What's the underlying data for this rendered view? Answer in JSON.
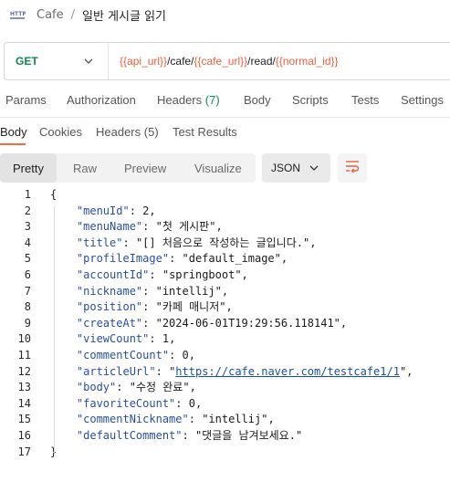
{
  "breadcrumb": {
    "parent": "Cafe",
    "separator": "/",
    "current": "일반 게시글 읽기"
  },
  "request": {
    "method": "GET",
    "url_parts": [
      {
        "text": "{{api_url}}",
        "var": true
      },
      {
        "text": "/cafe/",
        "var": false
      },
      {
        "text": "{{cafe_url}}",
        "var": true
      },
      {
        "text": "/read/",
        "var": false
      },
      {
        "text": "{{normal_id}}",
        "var": true
      }
    ]
  },
  "request_tabs": {
    "params": "Params",
    "authorization": "Authorization",
    "headers": "Headers",
    "headers_count": "(7)",
    "body": "Body",
    "scripts": "Scripts",
    "tests": "Tests",
    "settings": "Settings"
  },
  "response_tabs": {
    "body": "Body",
    "cookies": "Cookies",
    "headers": "Headers",
    "headers_count": "(5)",
    "test_results": "Test Results"
  },
  "view_modes": {
    "pretty": "Pretty",
    "raw": "Raw",
    "preview": "Preview",
    "visualize": "Visualize"
  },
  "format": "JSON",
  "response_json": [
    {
      "key": "menuId",
      "value": "2",
      "type": "number"
    },
    {
      "key": "menuName",
      "value": "\"첫 게시판\"",
      "type": "string"
    },
    {
      "key": "title",
      "value": "\"[] 처음으로 작성하는 글입니다.\"",
      "type": "string"
    },
    {
      "key": "profileImage",
      "value": "\"default_image\"",
      "type": "string"
    },
    {
      "key": "accountId",
      "value": "\"springboot\"",
      "type": "string"
    },
    {
      "key": "nickname",
      "value": "\"intellij\"",
      "type": "string"
    },
    {
      "key": "position",
      "value": "\"카페 매니저\"",
      "type": "string"
    },
    {
      "key": "createAt",
      "value": "\"2024-06-01T19:29:56.118141\"",
      "type": "string"
    },
    {
      "key": "viewCount",
      "value": "1",
      "type": "number"
    },
    {
      "key": "commentCount",
      "value": "0",
      "type": "number"
    },
    {
      "key": "articleUrl",
      "value": "https://cafe.naver.com/testcafe1/1",
      "type": "link"
    },
    {
      "key": "body",
      "value": "\"수정 완료\"",
      "type": "string"
    },
    {
      "key": "favoriteCount",
      "value": "0",
      "type": "number"
    },
    {
      "key": "commentNickname",
      "value": "\"intellij\"",
      "type": "string"
    },
    {
      "key": "defaultComment",
      "value": "\"댓글을 남겨보세요.\"",
      "type": "string"
    }
  ],
  "line_numbers": [
    "1",
    "2",
    "3",
    "4",
    "5",
    "6",
    "7",
    "8",
    "9",
    "10",
    "11",
    "12",
    "13",
    "14",
    "15",
    "16",
    "17"
  ],
  "brace_open": "{",
  "brace_close": "}",
  "icons": {
    "http": "http-request-icon",
    "method_dropdown": "chevron-down-icon",
    "format_dropdown": "chevron-down-icon",
    "wrap": "wrap-lines-icon"
  },
  "colors": {
    "method": "#0f8a4f",
    "url_variable": "#e8603c",
    "accent": "#f26b3a",
    "count": "#0f8a4f"
  }
}
